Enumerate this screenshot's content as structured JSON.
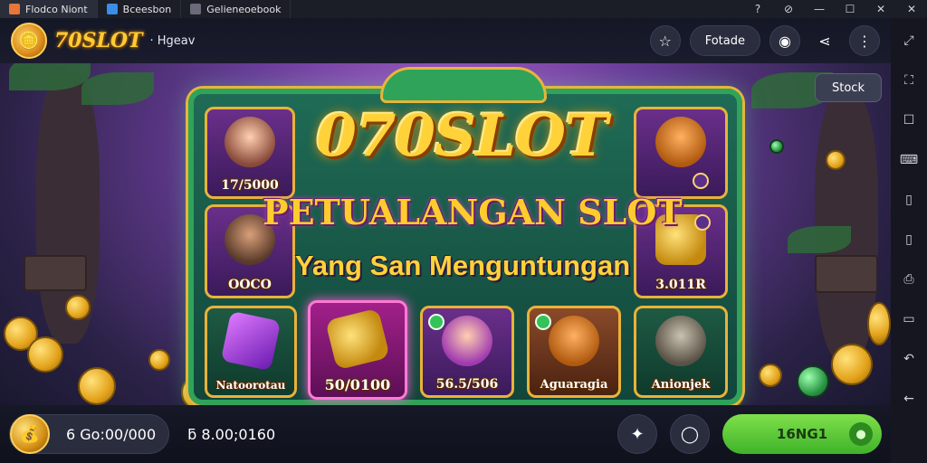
{
  "window": {
    "tabs": [
      {
        "label": "Flodco Niont",
        "color": "#e8753a"
      },
      {
        "label": "Bceesbon",
        "color": "#3a8ee8"
      },
      {
        "label": "Gelieneoebook",
        "color": "#6a6a7a"
      }
    ],
    "controls": [
      "?",
      "⊘",
      "—",
      "☐",
      "✕",
      "✕"
    ]
  },
  "appbar": {
    "brand": "70SLOT",
    "subtitle": "· Hgeav",
    "fav_label": "☆",
    "action_label": "Fotade",
    "chat_label": "◉",
    "share_label": "⋖",
    "more_label": "⋮"
  },
  "stock_button": "Stock",
  "hero": {
    "title": "070SLOT",
    "subtitle1": "PETUALANGAN SLOT",
    "subtitle2": "Yang San Menguntungan"
  },
  "tiles": [
    {
      "caption": "17/5000"
    },
    {
      "caption": "OOCO"
    },
    {
      "caption": ""
    },
    {
      "caption": "3.011R"
    },
    {
      "caption": "Natoorotau"
    },
    {
      "caption": "50/0100"
    },
    {
      "caption": "56.5/506"
    },
    {
      "caption": "Aguaragia"
    },
    {
      "caption": "Anionjek"
    }
  ],
  "bottombar": {
    "balance": "6 Go:00/000",
    "bet": "ƃ 8.00;0160",
    "play_label": "16NG1"
  },
  "colors": {
    "accent_gold": "#ffd23a",
    "frame_green": "#2fa35a",
    "play_green": "#5fca36"
  }
}
